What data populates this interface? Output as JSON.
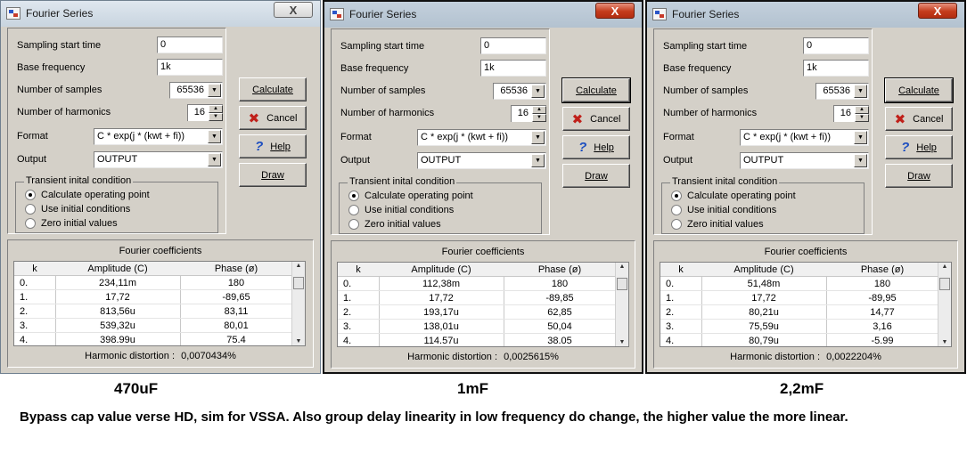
{
  "windows": [
    {
      "title": "Fourier Series",
      "close_symbol": "X",
      "fields": {
        "sampling_start_time": {
          "label": "Sampling start time",
          "value": "0"
        },
        "base_frequency": {
          "label": "Base frequency",
          "value": "1k"
        },
        "number_of_samples": {
          "label": "Number of samples",
          "value": "65536"
        },
        "number_of_harmonics": {
          "label": "Number of harmonics",
          "value": "16"
        },
        "format": {
          "label": "Format",
          "value": "C * exp(j * (kwt + fi))"
        },
        "output": {
          "label": "Output",
          "value": "OUTPUT"
        }
      },
      "transient": {
        "title": "Transient inital condition",
        "options": [
          "Calculate operating point",
          "Use initial conditions",
          "Zero initial values"
        ]
      },
      "buttons": {
        "calculate": "Calculate",
        "cancel": "Cancel",
        "help": "Help",
        "draw": "Draw"
      },
      "coefficients": {
        "title": "Fourier coefficients",
        "headers": [
          "k",
          "Amplitude (C)",
          "Phase (ø)"
        ],
        "rows": [
          [
            "0.",
            "234,11m",
            "180"
          ],
          [
            "1.",
            "17,72",
            "-89,65"
          ],
          [
            "2.",
            "813,56u",
            "83,11"
          ],
          [
            "3.",
            "539,32u",
            "80,01"
          ],
          [
            "4.",
            "398.99u",
            "75.4"
          ]
        ]
      },
      "harmonic_distortion": {
        "label": "Harmonic distortion :",
        "value": "0,0070434%"
      }
    },
    {
      "title": "Fourier Series",
      "close_symbol": "X",
      "fields": {
        "sampling_start_time": {
          "label": "Sampling start time",
          "value": "0"
        },
        "base_frequency": {
          "label": "Base frequency",
          "value": "1k"
        },
        "number_of_samples": {
          "label": "Number of samples",
          "value": "65536"
        },
        "number_of_harmonics": {
          "label": "Number of harmonics",
          "value": "16"
        },
        "format": {
          "label": "Format",
          "value": "C * exp(j * (kwt + fi))"
        },
        "output": {
          "label": "Output",
          "value": "OUTPUT"
        }
      },
      "transient": {
        "title": "Transient inital condition",
        "options": [
          "Calculate operating point",
          "Use initial conditions",
          "Zero initial values"
        ]
      },
      "buttons": {
        "calculate": "Calculate",
        "cancel": "Cancel",
        "help": "Help",
        "draw": "Draw"
      },
      "coefficients": {
        "title": "Fourier coefficients",
        "headers": [
          "k",
          "Amplitude (C)",
          "Phase (ø)"
        ],
        "rows": [
          [
            "0.",
            "112,38m",
            "180"
          ],
          [
            "1.",
            "17,72",
            "-89,85"
          ],
          [
            "2.",
            "193,17u",
            "62,85"
          ],
          [
            "3.",
            "138,01u",
            "50,04"
          ],
          [
            "4.",
            "114.57u",
            "38.05"
          ]
        ]
      },
      "harmonic_distortion": {
        "label": "Harmonic distortion :",
        "value": "0,0025615%"
      }
    },
    {
      "title": "Fourier Series",
      "close_symbol": "X",
      "fields": {
        "sampling_start_time": {
          "label": "Sampling start time",
          "value": "0"
        },
        "base_frequency": {
          "label": "Base frequency",
          "value": "1k"
        },
        "number_of_samples": {
          "label": "Number of samples",
          "value": "65536"
        },
        "number_of_harmonics": {
          "label": "Number of harmonics",
          "value": "16"
        },
        "format": {
          "label": "Format",
          "value": "C * exp(j * (kwt + fi))"
        },
        "output": {
          "label": "Output",
          "value": "OUTPUT"
        }
      },
      "transient": {
        "title": "Transient inital condition",
        "options": [
          "Calculate operating point",
          "Use initial conditions",
          "Zero initial values"
        ]
      },
      "buttons": {
        "calculate": "Calculate",
        "cancel": "Cancel",
        "help": "Help",
        "draw": "Draw"
      },
      "coefficients": {
        "title": "Fourier coefficients",
        "headers": [
          "k",
          "Amplitude (C)",
          "Phase (ø)"
        ],
        "rows": [
          [
            "0.",
            "51,48m",
            "180"
          ],
          [
            "1.",
            "17,72",
            "-89,95"
          ],
          [
            "2.",
            "80,21u",
            "14,77"
          ],
          [
            "3.",
            "75,59u",
            "3,16"
          ],
          [
            "4.",
            "80,79u",
            "-5.99"
          ]
        ]
      },
      "harmonic_distortion": {
        "label": "Harmonic distortion :",
        "value": "0,0022204%"
      }
    }
  ],
  "captions": [
    "470uF",
    "1mF",
    "2,2mF"
  ],
  "note": "Bypass cap value verse HD, sim for VSSA. Also group delay linearity in low frequency do change, the higher value the more linear.",
  "icons": {
    "cancel": "red-x-icon",
    "help": "blue-question-icon",
    "app": "fourier-app-icon"
  }
}
